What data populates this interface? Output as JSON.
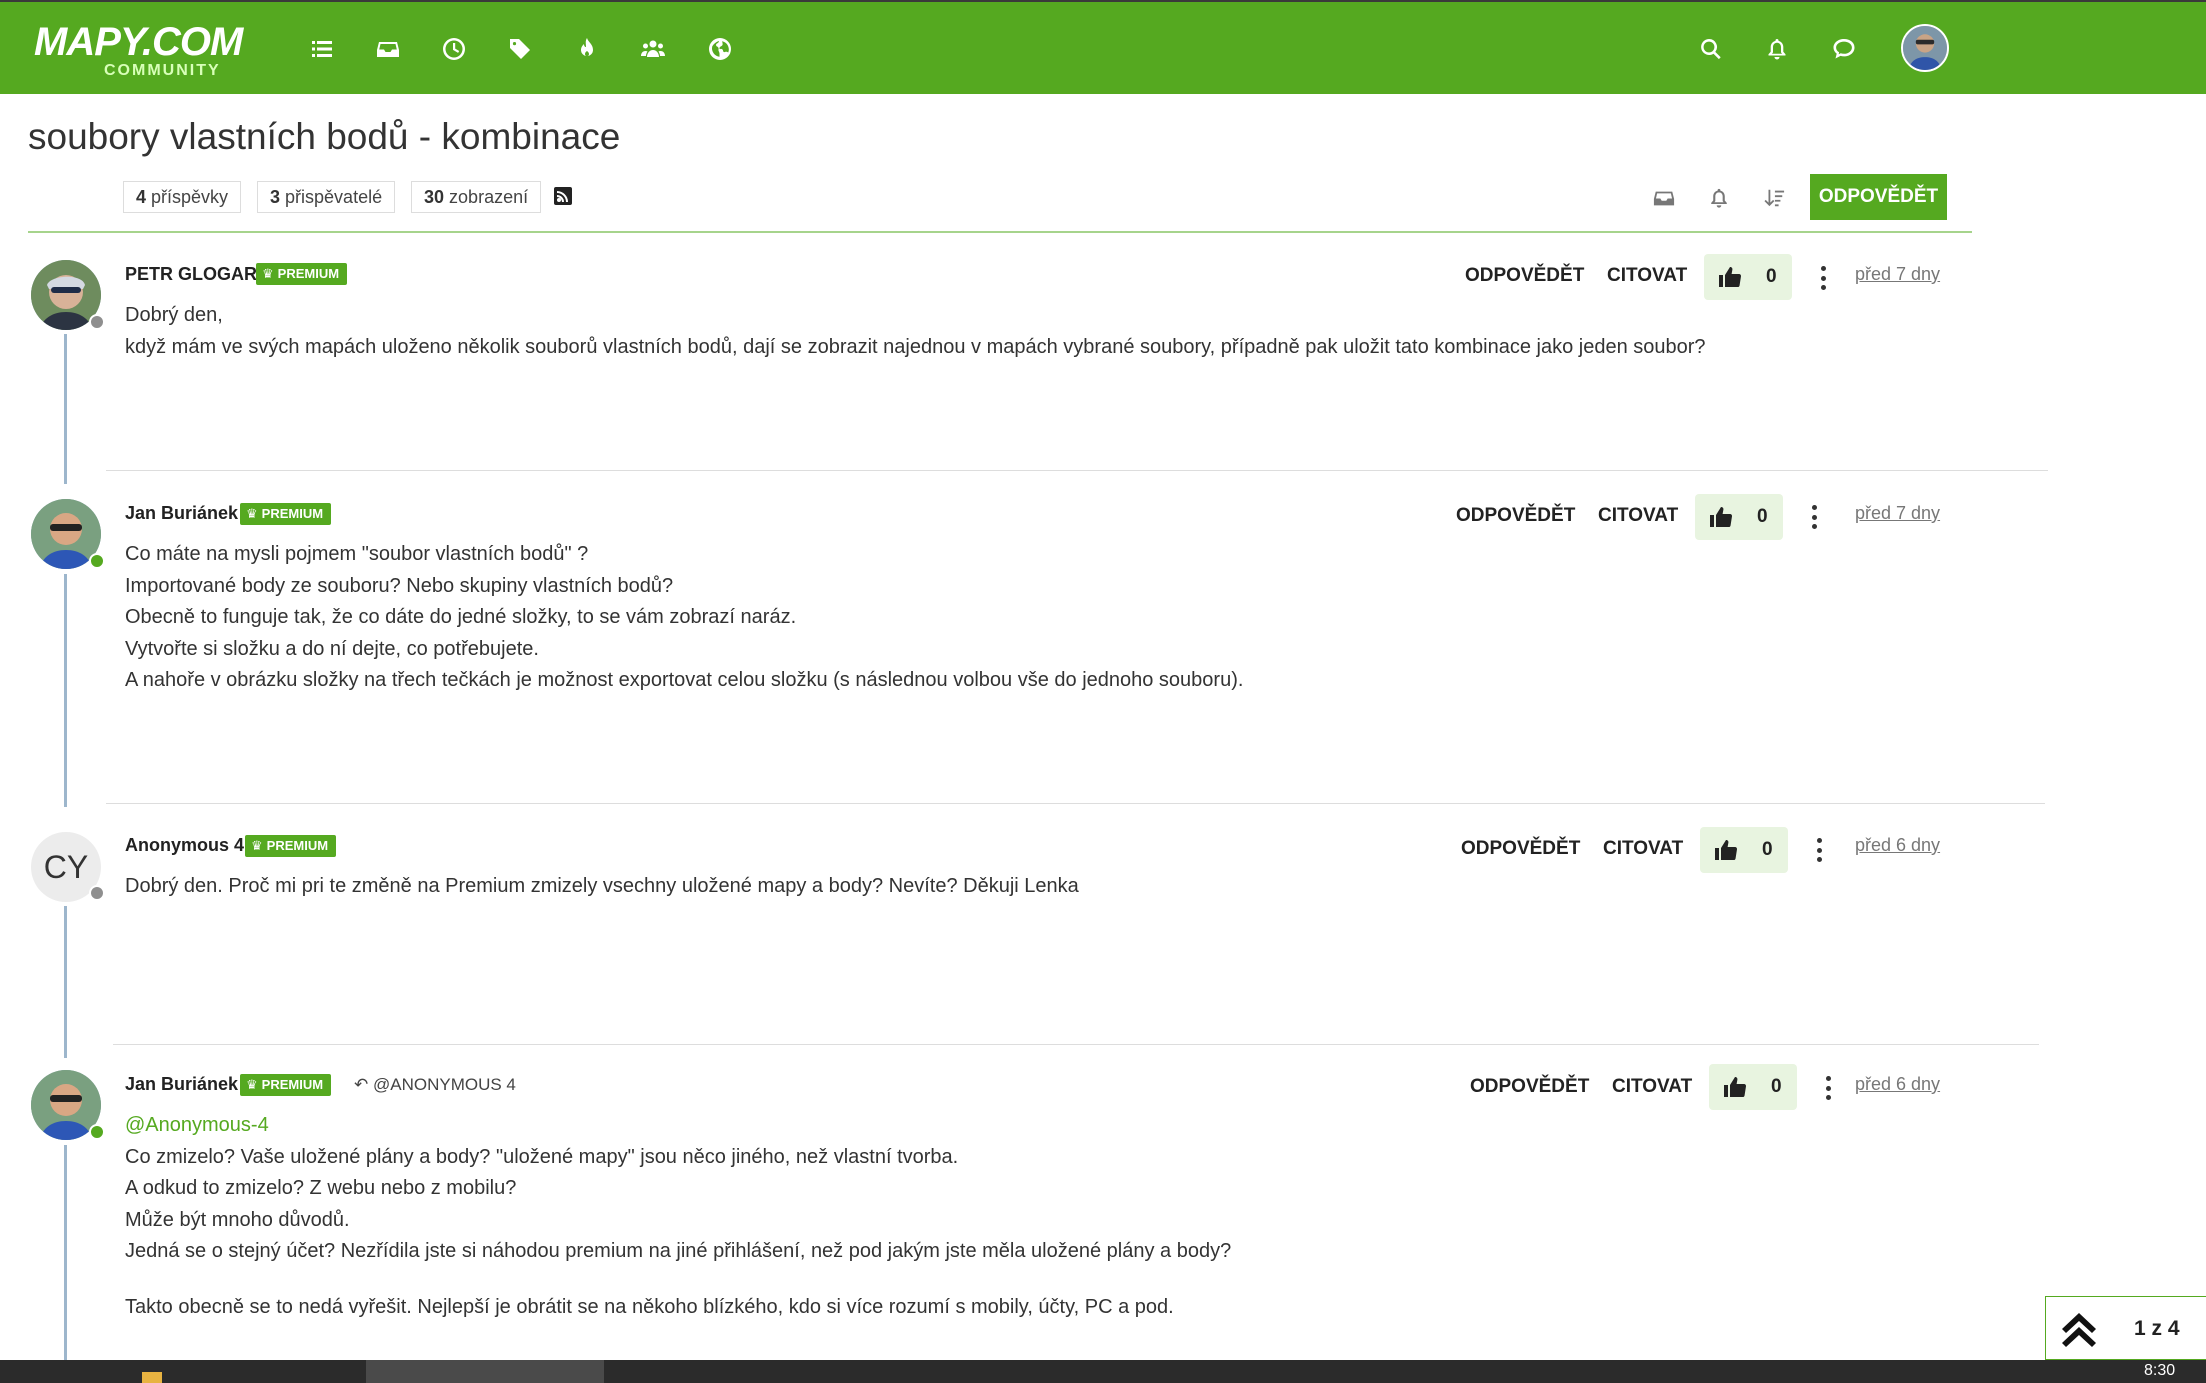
{
  "brand": {
    "logo_main": "MAPY.COM",
    "logo_sub": "COMMUNITY",
    "accent": "#55a920"
  },
  "nav": {
    "left_icons": [
      "list-icon",
      "inbox-icon",
      "clock-icon",
      "tags-icon",
      "fire-icon",
      "users-icon",
      "globe-icon"
    ],
    "right_icons": [
      "search-icon",
      "bell-icon",
      "chat-icon"
    ]
  },
  "topic": {
    "title": "soubory vlastních bodů - kombinace",
    "stats": [
      {
        "count": "4",
        "label": "příspěvky"
      },
      {
        "count": "3",
        "label": "přispěvatelé"
      },
      {
        "count": "30",
        "label": "zobrazení"
      }
    ],
    "reply_button": "ODPOVĚDĚT"
  },
  "actions": {
    "reply": "ODPOVĚDĚT",
    "quote": "CITOVAT"
  },
  "posts": [
    {
      "author": "PETR GLOGAR",
      "badge": "PREMIUM",
      "votes": "0",
      "time": "před 7 dny",
      "status": "offline",
      "lines": [
        "Dobrý den,",
        "když mám ve svých mapách uloženo několik souborů vlastních bodů, dají se zobrazit najednou v mapách vybrané soubory, případně pak uložit tato kombinace jako jeden soubor?"
      ]
    },
    {
      "author": "Jan Buriánek",
      "badge": "PREMIUM",
      "votes": "0",
      "time": "před 7 dny",
      "status": "online",
      "lines": [
        "Co máte na mysli pojmem \"soubor vlastních bodů\" ?",
        "Importované body ze souboru? Nebo skupiny vlastních bodů?",
        "Obecně to funguje tak, že co dáte do jedné složky, to se vám zobrazí naráz.",
        "Vytvořte si složku a do ní dejte, co potřebujete.",
        "A nahoře v obrázku složky na třech tečkách je možnost exportovat celou složku (s následnou volbou vše do jednoho souboru)."
      ]
    },
    {
      "author": "Anonymous 4",
      "avatar_initials": "CY",
      "badge": "PREMIUM",
      "votes": "0",
      "time": "před 6 dny",
      "status": "offline",
      "lines": [
        "Dobrý den. Proč mi pri te změně na Premium zmizely vsechny uložené mapy a body? Nevíte? Děkuji Lenka"
      ]
    },
    {
      "author": "Jan Buriánek",
      "badge": "PREMIUM",
      "reply_to": "@ANONYMOUS 4",
      "votes": "0",
      "time": "před 6 dny",
      "status": "online",
      "mention": "@Anonymous-4",
      "lines": [
        "Co zmizelo? Vaše uložené plány a body? \"uložené mapy\" jsou něco jiného, než vlastní tvorba.",
        "A odkud to zmizelo? Z webu nebo z mobilu?",
        "Může být mnoho důvodů.",
        "Jedná se o stejný účet? Nezřídila jste si náhodou premium na jiné přihlášení, než pod jakým jste měla uložené plány a body?"
      ],
      "extra_line": "Takto obecně se to nedá vyřešit. Nejlepší je obrátit se na někoho blízkého, kdo si více rozumí s mobily, účty, PC a pod."
    }
  ],
  "pagination": {
    "label": "1 z 4"
  },
  "taskbar": {
    "clock": "8:30"
  }
}
